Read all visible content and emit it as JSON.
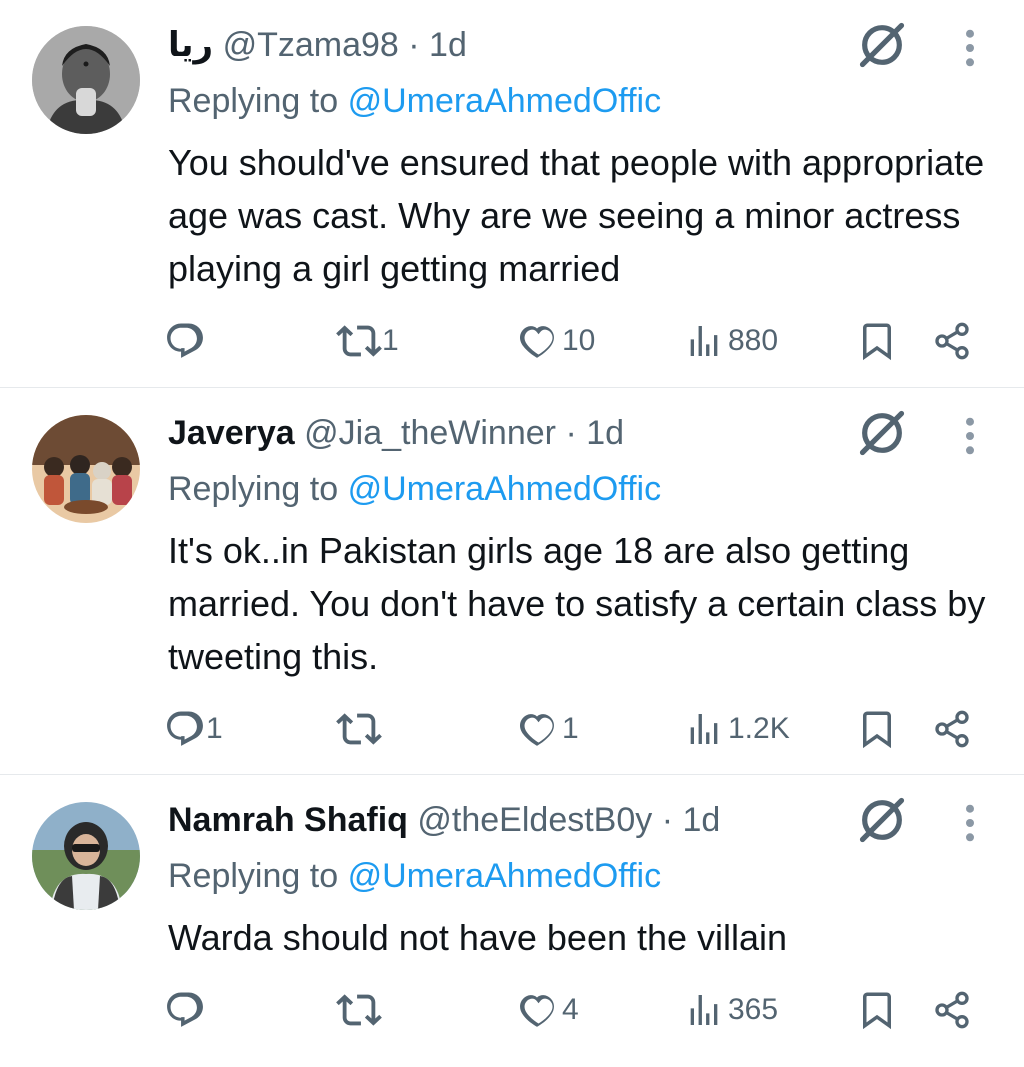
{
  "tweets": [
    {
      "display_name": "ريا",
      "handle": "@Tzama98",
      "separator": "·",
      "time": "1d",
      "replying_prefix": "Replying to",
      "replying_handle": "@UmeraAhmedOffic",
      "text": "You should've ensured that people with appropriate age was cast. Why are we seeing a minor actress playing a girl getting married",
      "replies": "",
      "reposts": "1",
      "likes": "10",
      "views": "880"
    },
    {
      "display_name": "Javerya",
      "handle": "@Jia_theWinner",
      "separator": "·",
      "time": "1d",
      "replying_prefix": "Replying to",
      "replying_handle": "@UmeraAhmedOffic",
      "text": "It's ok..in Pakistan girls age 18 are also getting married. You don't have to satisfy a certain class by tweeting this.",
      "replies": "1",
      "reposts": "",
      "likes": "1",
      "views": "1.2K"
    },
    {
      "display_name": "Namrah Shafiq",
      "handle": "@theEldestB0y",
      "separator": "·",
      "time": "1d",
      "replying_prefix": "Replying to",
      "replying_handle": "@UmeraAhmedOffic",
      "text": "Warda should not have been the villain",
      "replies": "",
      "reposts": "",
      "likes": "4",
      "views": "365"
    }
  ],
  "icons": {
    "reply": "reply-icon",
    "repost": "repost-icon",
    "like": "like-icon",
    "views": "views-icon",
    "bookmark": "bookmark-icon",
    "share": "share-icon",
    "grok": "grok-icon",
    "more": "more-vertical-icon"
  },
  "colors": {
    "link": "#1d9bf0",
    "muted": "#536471",
    "text": "#0f1419"
  }
}
